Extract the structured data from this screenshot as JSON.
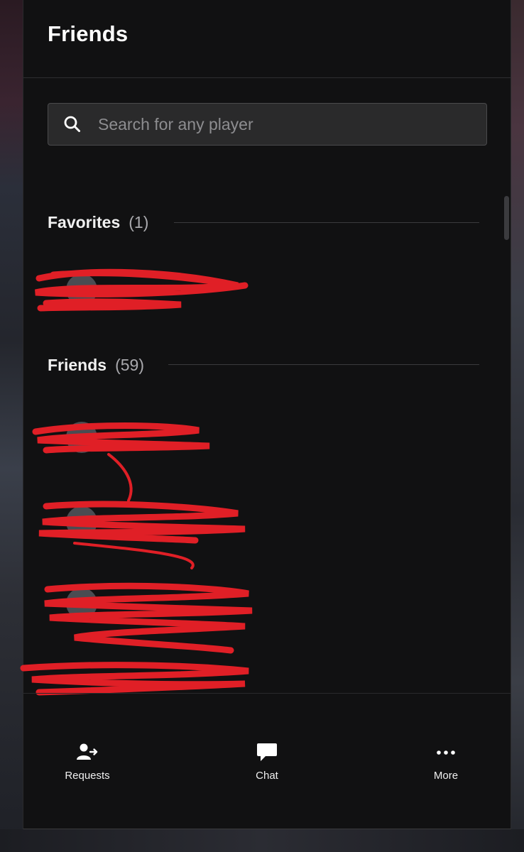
{
  "header": {
    "title": "Friends"
  },
  "search": {
    "placeholder": "Search for any player",
    "value": ""
  },
  "sections": [
    {
      "name": "Favorites",
      "count": "(1)"
    },
    {
      "name": "Friends",
      "count": "(59)"
    }
  ],
  "footer": {
    "items": [
      {
        "label": "Requests",
        "icon": "add-person-arrow-icon"
      },
      {
        "label": "Chat",
        "icon": "speech-bubble-icon"
      },
      {
        "label": "More",
        "icon": "three-dots-icon"
      }
    ]
  },
  "colors": {
    "panel_bg": "#111112",
    "text": "#ffffff",
    "muted": "#a9a9ad",
    "redaction": "#e01f26"
  },
  "icons": {
    "search": "search-icon"
  }
}
